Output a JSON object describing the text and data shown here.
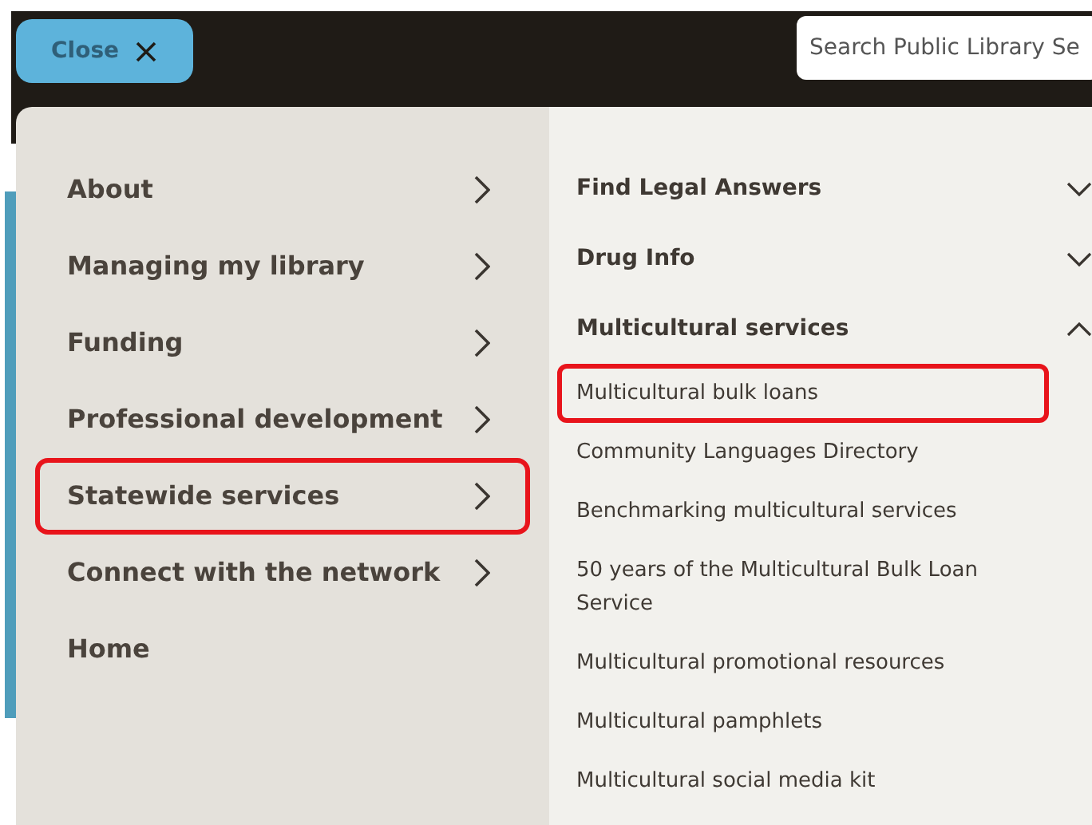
{
  "header": {
    "close_button": "Close",
    "search": {
      "placeholder": "Search Public Library Se"
    }
  },
  "menu": {
    "items": [
      {
        "label": "About",
        "highlighted": false
      },
      {
        "label": "Managing my library",
        "highlighted": false
      },
      {
        "label": "Funding",
        "highlighted": false
      },
      {
        "label": "Professional development",
        "highlighted": false
      },
      {
        "label": "Statewide services",
        "highlighted": true
      },
      {
        "label": "Connect with the network",
        "highlighted": false
      },
      {
        "label": "Home",
        "highlighted": false,
        "kind": "link"
      }
    ]
  },
  "submenu": {
    "sections": [
      {
        "label": "Find Legal Answers",
        "expanded": false
      },
      {
        "label": "Drug Info",
        "expanded": false
      },
      {
        "label": "Multicultural services",
        "expanded": true,
        "children": [
          {
            "label": "Multicultural bulk loans",
            "highlighted": true
          },
          {
            "label": "Community Languages Directory",
            "highlighted": false
          },
          {
            "label": "Benchmarking multicultural services",
            "highlighted": false
          },
          {
            "label": "50 years of the Multicultural Bulk Loan Service",
            "highlighted": false
          },
          {
            "label": "Multicultural promotional resources",
            "highlighted": false
          },
          {
            "label": "Multicultural pamphlets",
            "highlighted": false
          },
          {
            "label": "Multicultural social media kit",
            "highlighted": false
          }
        ]
      }
    ]
  }
}
